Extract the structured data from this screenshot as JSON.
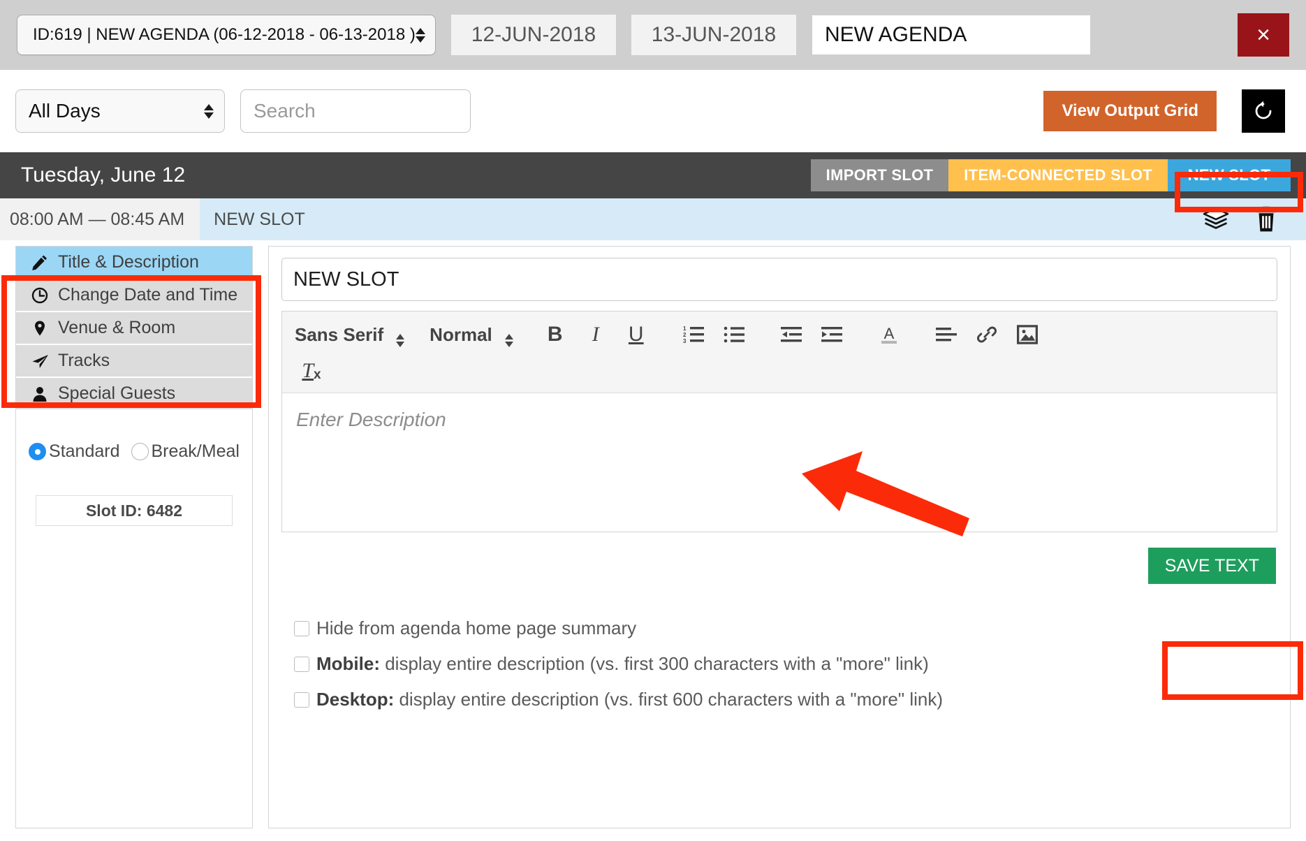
{
  "topbar": {
    "agenda_select_value": "ID:619 | NEW AGENDA (06-12-2018 - 06-13-2018 )",
    "start_date": "12-JUN-2018",
    "end_date": "13-JUN-2018",
    "agenda_name": "NEW AGENDA",
    "close_label": "×"
  },
  "filterbar": {
    "days_select_value": "All Days",
    "search_placeholder": "Search",
    "view_output_grid_label": "View Output Grid",
    "refresh_icon": "↻"
  },
  "dayheader": {
    "day_title": "Tuesday, June 12",
    "import_slot_label": "IMPORT SLOT",
    "item_connected_slot_label": "ITEM-CONNECTED SLOT",
    "new_slot_label": "NEW SLOT"
  },
  "slotrow": {
    "time_range": "08:00 AM — 08:45 AM",
    "slot_name": "NEW SLOT",
    "duplicate_icon": "layers-icon",
    "delete_icon": "trash-icon"
  },
  "sidebar": {
    "items": [
      {
        "label": "Title & Description",
        "icon": "pencil-icon",
        "active": true
      },
      {
        "label": "Change Date and Time",
        "icon": "clock-icon",
        "active": false
      },
      {
        "label": "Venue & Room",
        "icon": "map-pin-icon",
        "active": false
      },
      {
        "label": "Tracks",
        "icon": "paper-plane-icon",
        "active": false
      },
      {
        "label": "Special Guests",
        "icon": "user-icon",
        "active": false
      }
    ],
    "radios": [
      {
        "label": "Standard",
        "selected": true
      },
      {
        "label": "Break/Meal",
        "selected": false
      }
    ],
    "slot_id": "Slot ID: 6482"
  },
  "editor": {
    "title_value": "NEW SLOT",
    "font_family_value": "Sans Serif",
    "font_size_value": "Normal",
    "bold_label": "B",
    "italic_label": "I",
    "underline_label": "U",
    "clear_format_label": "T",
    "clear_format_sub": "x",
    "description_placeholder": "Enter Description",
    "save_text_label": "SAVE TEXT"
  },
  "options": [
    {
      "text": "Hide from agenda home page summary",
      "bold": "",
      "checked": false
    },
    {
      "bold": "Mobile:",
      "text": " display entire description (vs. first 300 characters with a \"more\" link)",
      "checked": false
    },
    {
      "bold": "Desktop:",
      "text": " display entire description (vs. first 600 characters with a \"more\" link)",
      "checked": false
    }
  ],
  "colors": {
    "accent_orange": "#d1642b",
    "accent_blue": "#3ba7dd",
    "accent_green": "#1e9e5d",
    "accent_amber": "#ffc04d",
    "close_red": "#991418",
    "annotation_red": "#fb2b0a",
    "dayheader_dark": "#454545",
    "slotrow_blue": "#d6ebf7"
  }
}
